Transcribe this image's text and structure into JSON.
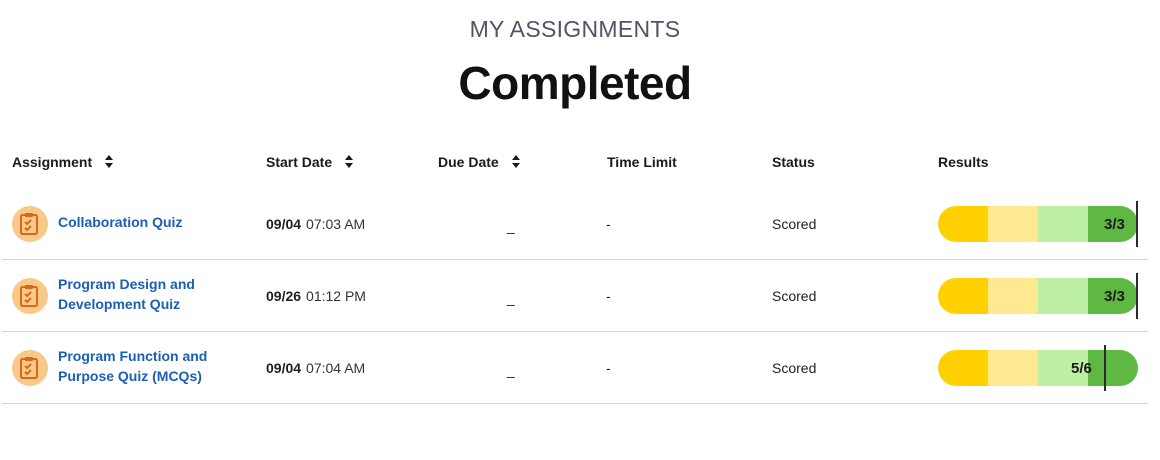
{
  "page": {
    "eyebrow": "MY ASSIGNMENTS",
    "title": "Completed"
  },
  "columns": {
    "assignment": "Assignment",
    "start_date": "Start Date",
    "due_date": "Due Date",
    "time_limit": "Time Limit",
    "status": "Status",
    "results": "Results"
  },
  "icons": {
    "sort": "sort-icon",
    "quiz": "quiz-checklist-icon"
  },
  "colors": {
    "link": "#1a5fb4",
    "quiz_icon_bg": "#f8c989",
    "quiz_icon_fg": "#d9681e",
    "result_segments": [
      "#ffd100",
      "#fde98f",
      "#bdf0a4",
      "#5eb842"
    ]
  },
  "assignments": [
    {
      "title": "Collaboration Quiz",
      "start_date": "09/04",
      "start_time": "07:03 AM",
      "due_date": "_",
      "time_limit": "-",
      "status": "Scored",
      "score": "3/3",
      "score_fraction": 1.0
    },
    {
      "title": "Program Design and Development Quiz",
      "start_date": "09/26",
      "start_time": "01:12 PM",
      "due_date": "_",
      "time_limit": "-",
      "status": "Scored",
      "score": "3/3",
      "score_fraction": 1.0
    },
    {
      "title": "Program Function and Purpose Quiz (MCQs)",
      "start_date": "09/04",
      "start_time": "07:04 AM",
      "due_date": "_",
      "time_limit": "-",
      "status": "Scored",
      "score": "5/6",
      "score_fraction": 0.8333
    }
  ]
}
